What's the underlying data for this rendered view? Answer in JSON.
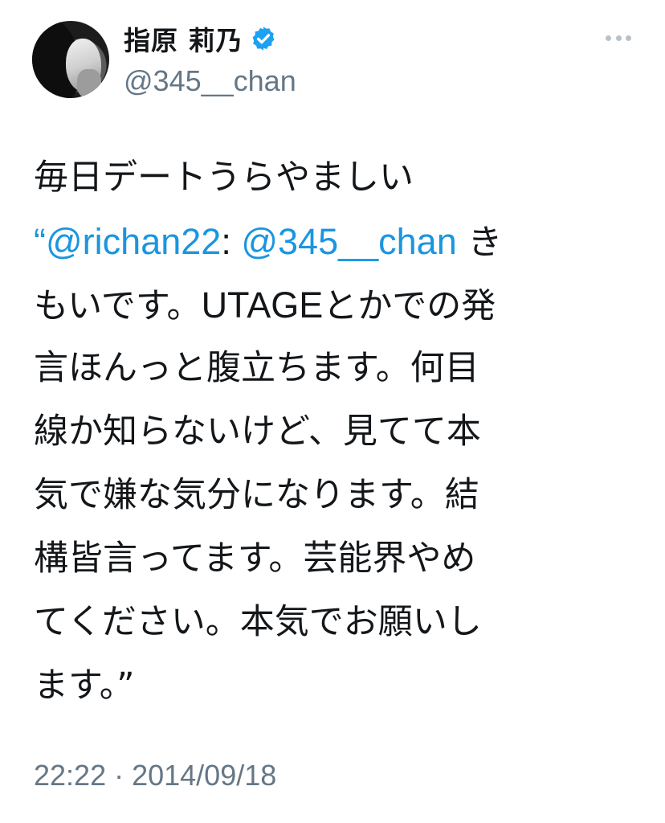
{
  "header": {
    "display_name": "指原 莉乃",
    "handle": "@345__chan",
    "verified_icon": "verified-badge-icon",
    "more_icon": "more-options-icon"
  },
  "tweet": {
    "lines": [
      [
        "毎日デートうらやましい"
      ],
      [
        "“",
        "@richan22",
        ": ",
        "@345__chan",
        " き"
      ],
      [
        "もいです。",
        "UTAGE",
        "とかでの発"
      ],
      [
        "言ほんっと腹立ちます。何目"
      ],
      [
        "線か知らないけど、見てて本"
      ],
      [
        "気で嫌な気分になります。結"
      ],
      [
        "構皆言ってます。芸能界やめ"
      ],
      [
        "てください。本気でお願いし"
      ],
      [
        "ます。”"
      ]
    ]
  },
  "footer": {
    "time": "22:22",
    "separator": " · ",
    "date": "2014/09/18"
  },
  "colors": {
    "link": "#1b95e0",
    "secondary_text": "#657786",
    "verified_badge": "#1da1f2"
  }
}
